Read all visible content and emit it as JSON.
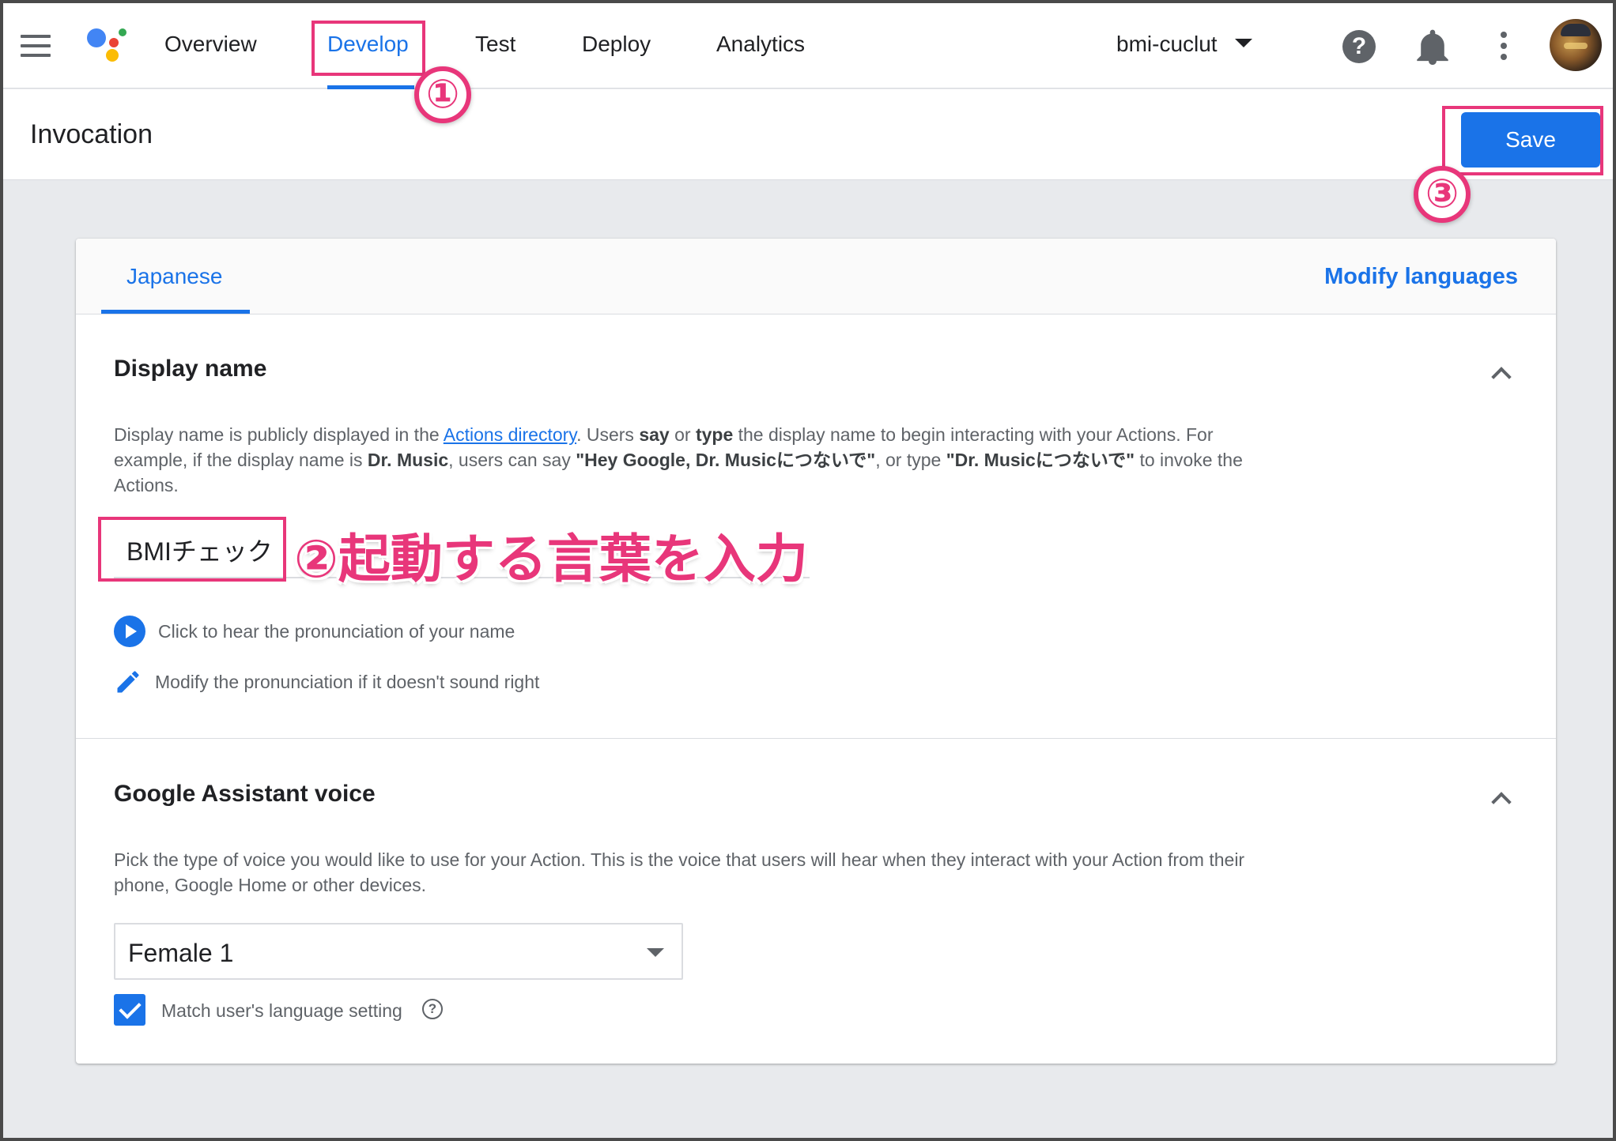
{
  "topbar": {
    "nav": [
      "Overview",
      "Develop",
      "Test",
      "Deploy",
      "Analytics"
    ],
    "active_tab": "Develop",
    "project": "bmi-cuclut",
    "icons": [
      "menu-icon",
      "assistant-logo",
      "help-icon",
      "bell-icon",
      "more-vert-icon",
      "avatar"
    ]
  },
  "subheader": {
    "title": "Invocation",
    "save_label": "Save"
  },
  "tabs": {
    "language": "Japanese",
    "modify_label": "Modify languages"
  },
  "display_name": {
    "title": "Display name",
    "desc_1": "Display name is publicly displayed in the ",
    "desc_link": "Actions directory",
    "desc_2": ". Users ",
    "desc_say": "say",
    "desc_3": " or ",
    "desc_type": "type",
    "desc_4": " the display name to begin interacting with your Actions. For example, if the display name is ",
    "desc_dr": "Dr. Music",
    "desc_5": ", users can say ",
    "desc_quote1": "\"Hey Google, Dr. Musicにつないで\"",
    "desc_6": ", or type ",
    "desc_quote2": "\"Dr. Musicにつないで\"",
    "desc_7": " to invoke the Actions.",
    "value": "BMIチェック",
    "hear_label": "Click to hear the pronunciation of your name",
    "modify_label": "Modify the pronunciation if it doesn't sound right"
  },
  "voice": {
    "title": "Google Assistant voice",
    "desc": "Pick the type of voice you would like to use for your Action. This is the voice that users will hear when they interact with your Action from their phone, Google Home or other devices.",
    "selected": "Female 1",
    "match_label": "Match user's language setting",
    "match_checked": true
  },
  "annotations": {
    "step1": "①",
    "step2_text": "②起動する言葉を入力",
    "step3": "③"
  },
  "colors": {
    "accent": "#1a73e8",
    "annotation": "#e8367a",
    "background": "#e8eaed"
  }
}
